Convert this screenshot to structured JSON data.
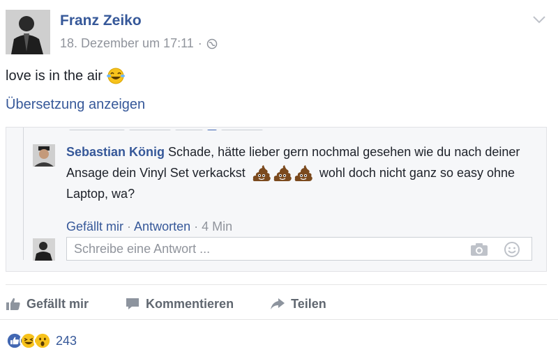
{
  "post": {
    "author": "Franz Zeiko",
    "timestamp": "18. Dezember um 17:11",
    "separator": "·",
    "text": "love is in the air",
    "translate_link": "Übersetzung anzeigen",
    "emoji": "laughing-tears-emoji"
  },
  "comment": {
    "author": "Sebastian König",
    "text_part1": "Schade, hätte lieber gern nochmal gesehen wie du nach deiner Ansage dein Vinyl Set verkackst",
    "text_part2": "wohl doch nicht ganz so easy ohne Laptop, wa?",
    "like_label": "Gefällt mir",
    "sep1": "·",
    "reply_label": "Antworten",
    "sep2": "·",
    "time": "4 Min"
  },
  "reply_input": {
    "placeholder": "Schreibe eine Antwort ..."
  },
  "actions": {
    "like": "Gefällt mir",
    "comment": "Kommentieren",
    "share": "Teilen"
  },
  "reactions": {
    "types": [
      "like",
      "haha",
      "wow"
    ],
    "count": "243"
  },
  "colors": {
    "link": "#365899",
    "meta": "#90949c",
    "like_blue": "#4267b2",
    "emoji_yellow": "#f7c21c"
  }
}
